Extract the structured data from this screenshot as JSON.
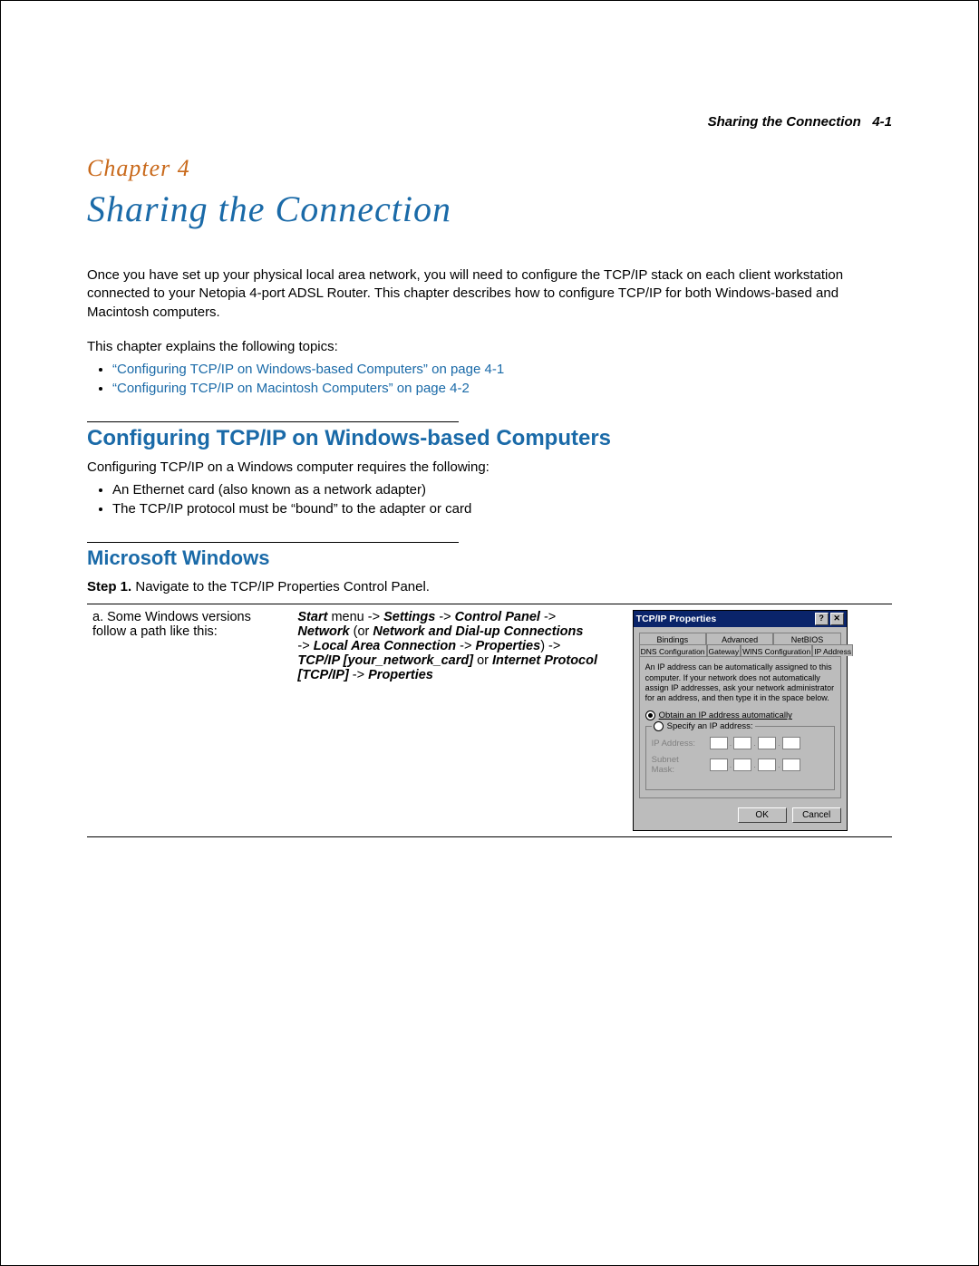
{
  "header": {
    "running_title": "Sharing the Connection",
    "page_ref": "4-1"
  },
  "chapter": {
    "label": "Chapter 4",
    "title": "Sharing the Connection"
  },
  "intro": {
    "p1": "Once you have set up your physical local area network, you will need to configure the TCP/IP stack on each client workstation connected to your Netopia 4-port ADSL Router. This chapter describes how to configure TCP/IP for both Windows-based and Macintosh computers.",
    "p2": "This chapter explains the following topics:",
    "xrefs": [
      "“Configuring TCP/IP on Windows-based Computers” on page 4-1",
      "“Configuring TCP/IP on Macintosh Computers” on page 4-2"
    ]
  },
  "section1": {
    "heading": "Configuring TCP/IP on Windows-based Computers",
    "lead": "Configuring TCP/IP on a Windows computer requires the following:",
    "bullets": [
      "An Ethernet card (also known as a network adapter)",
      "The TCP/IP protocol must be “bound” to the adapter or card"
    ]
  },
  "section2": {
    "heading": "Microsoft Windows",
    "step_label": "Step 1.",
    "step_text": "Navigate to the TCP/IP Properties Control Panel.",
    "col_a_text": "a. Some Windows versions follow a path like this:",
    "path": {
      "p1a": "Start",
      "p1b": " menu -> ",
      "p1c": "Settings",
      "p1d": " -> ",
      "p1e": "Control Panel",
      "p1f": " -> ",
      "p2a": "Network",
      "p2b": " (or ",
      "p2c": "Network and Dial-up Connections",
      "p3a": " -> ",
      "p3b": "Local Area Connection",
      "p3c": " -> ",
      "p3d": "Properties",
      "p3e": ") -> ",
      "p4a": "TCP/IP [your_network_card]",
      "p4b": " or ",
      "p4c": "Internet Protocol [TCP/IP]",
      "p4d": " -> ",
      "p4e": "Properties"
    }
  },
  "dialog": {
    "title": "TCP/IP Properties",
    "help_btn": "?",
    "close_btn": "✕",
    "tabs_row1": [
      "Bindings",
      "Advanced",
      "NetBIOS"
    ],
    "tabs_row2": [
      "DNS Configuration",
      "Gateway",
      "WINS Configuration",
      "IP Address"
    ],
    "active_tab": "IP Address",
    "info_text": "An IP address can be automatically assigned to this computer. If your network does not automatically assign IP addresses, ask your network administrator for an address, and then type it in the space below.",
    "radio_auto": "Obtain an IP address automatically",
    "radio_specify": "Specify an IP address:",
    "field_ip": "IP Address:",
    "field_mask": "Subnet Mask:",
    "ok": "OK",
    "cancel": "Cancel"
  }
}
